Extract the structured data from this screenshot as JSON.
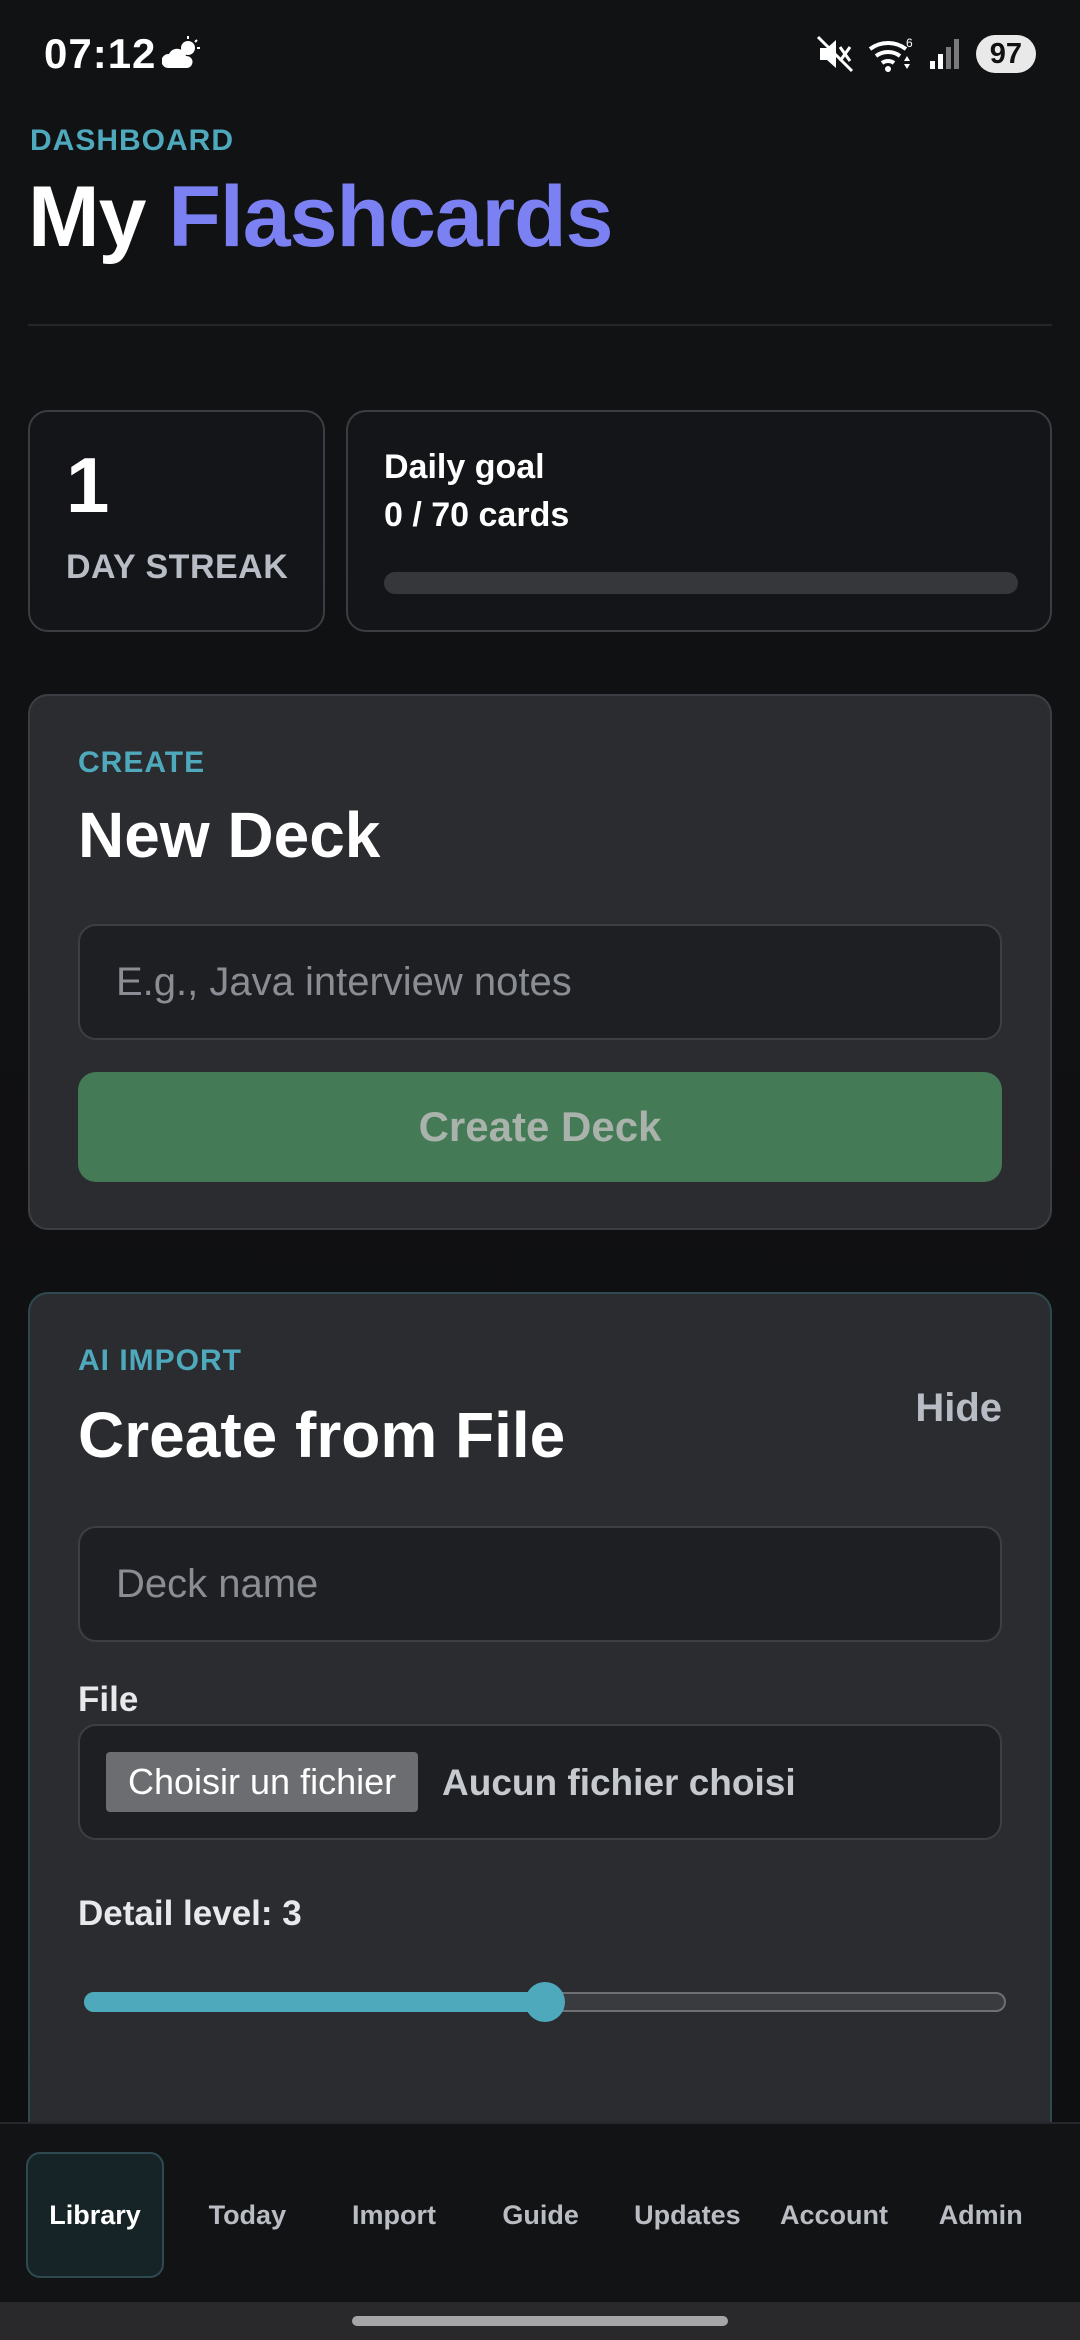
{
  "status_bar": {
    "time": "07:12",
    "battery": "97",
    "icons": [
      "weather-cloud-sun-icon",
      "mute-icon",
      "wifi-icon",
      "signal-icon"
    ],
    "wifi_badge": "6"
  },
  "header": {
    "eyebrow": "DASHBOARD",
    "title_plain": "My ",
    "title_accent": "Flashcards",
    "accent_color": "#7b80f2"
  },
  "stats": {
    "streak_value": "1",
    "streak_label": "DAY STREAK",
    "goal_title": "Daily goal",
    "goal_count": "0 / 70 cards",
    "goal_progress": 0
  },
  "create_panel": {
    "eyebrow": "CREATE",
    "title": "New Deck",
    "input_placeholder": "E.g., Java interview notes",
    "button_label": "Create Deck",
    "button_color": "#447a55"
  },
  "import_panel": {
    "eyebrow": "AI IMPORT",
    "title": "Create from File",
    "hide_label": "Hide",
    "deck_name_placeholder": "Deck name",
    "file_label": "File",
    "file_button_label": "Choisir un fichier",
    "file_status": "Aucun fichier choisi",
    "detail_label": "Detail level: 3",
    "detail_level_fraction": 0.5,
    "accent_color": "#4fa9bd"
  },
  "bottom_nav": {
    "items": [
      "Library",
      "Today",
      "Import",
      "Guide",
      "Updates",
      "Account",
      "Admin"
    ],
    "active": "Library"
  }
}
